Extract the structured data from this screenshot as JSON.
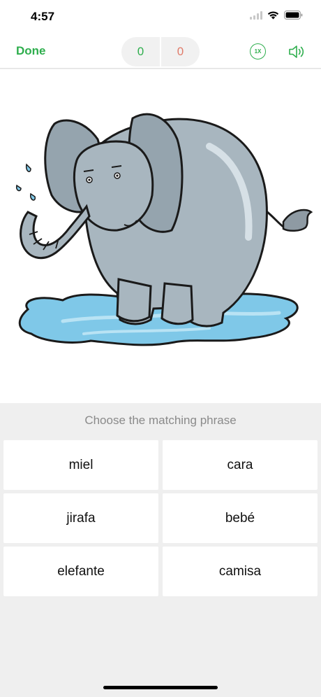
{
  "status_bar": {
    "time": "4:57"
  },
  "nav": {
    "done_label": "Done",
    "score_correct": "0",
    "score_wrong": "0",
    "speed_label": "1X"
  },
  "colors": {
    "accent_green": "#2eae4d",
    "wrong_red": "#e07b6a",
    "background": "#efefef"
  },
  "illustration": {
    "subject": "elephant-in-puddle"
  },
  "quiz": {
    "prompt": "Choose the matching phrase",
    "answers": [
      "miel",
      "cara",
      "jirafa",
      "bebé",
      "elefante",
      "camisa"
    ]
  }
}
